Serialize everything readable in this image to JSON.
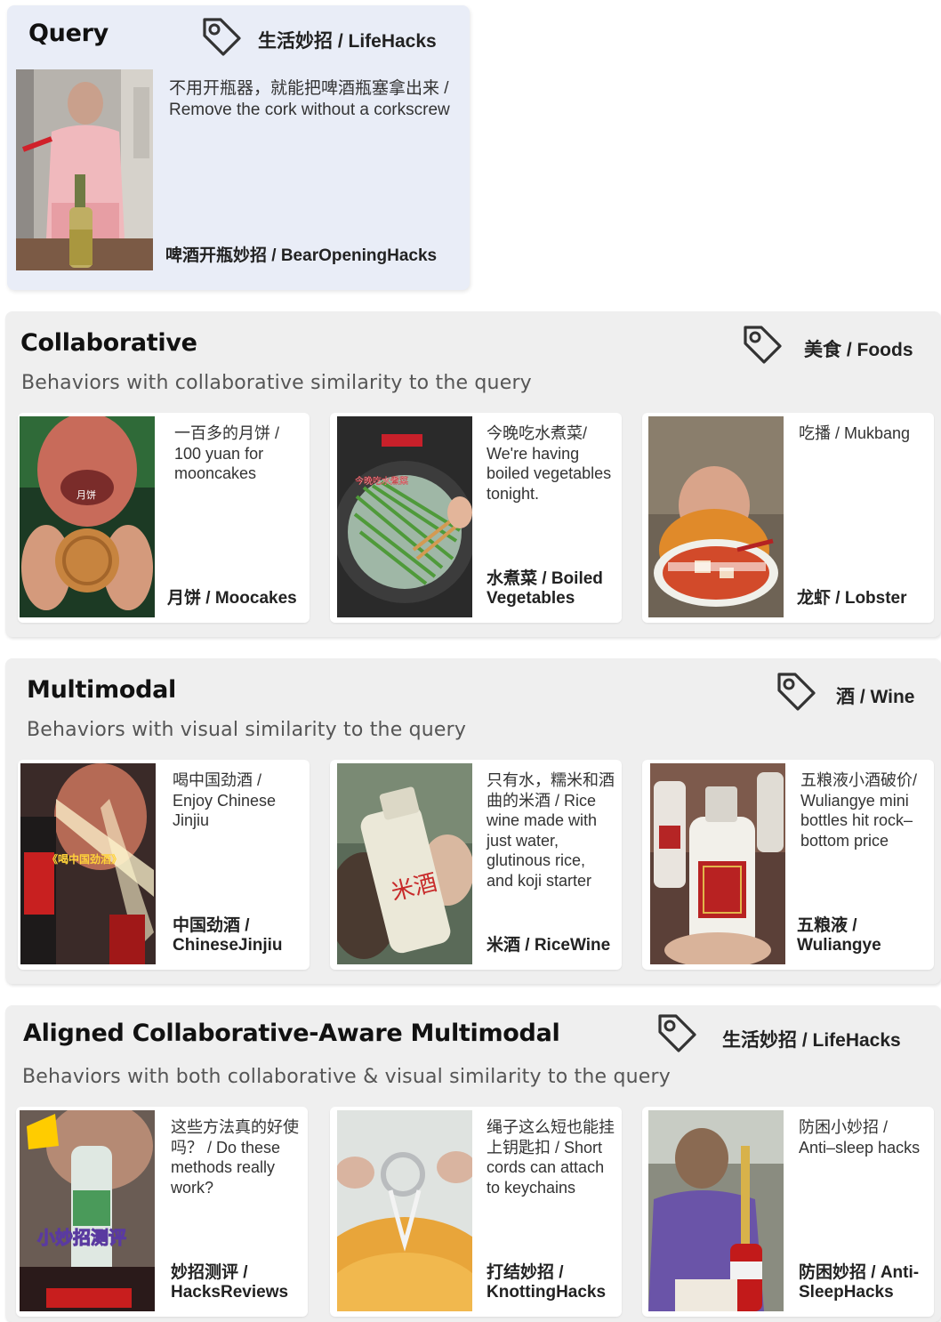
{
  "query": {
    "title": "Query",
    "tag": "生活妙招 / LifeHacks",
    "tag_icon": "tag-icon",
    "description": "不用开瓶器，就能把啤酒瓶塞拿出来 / Remove the cork without a corkscrew",
    "label": "啤酒开瓶妙招 / BearOpeningHacks"
  },
  "sections": [
    {
      "title": "Collaborative",
      "subtitle": "Behaviors with collaborative similarity to the query",
      "tag": "美食 / Foods",
      "tag_icon": "tag-icon",
      "cards": [
        {
          "description": "一百多的月饼 / 100 yuan for mooncakes",
          "label": "月饼 / Moocakes",
          "thumb_caption": "月饼"
        },
        {
          "description": "今晚吃水煮菜/ We're having boiled vegetables tonight.",
          "label": "水煮菜 / Boiled Vegetables",
          "thumb_caption": "今晚吃水煮菜"
        },
        {
          "description": "吃播 / Mukbang",
          "label": "龙虾 / Lobster",
          "thumb_caption": ""
        }
      ]
    },
    {
      "title": "Multimodal",
      "subtitle": "Behaviors with visual similarity to the query",
      "tag": "酒 / Wine",
      "tag_icon": "tag-icon",
      "cards": [
        {
          "description": "喝中国劲酒 / Enjoy Chinese Jinjiu",
          "label": "中国劲酒 / ChineseJinjiu",
          "thumb_caption": "《喝中国劲酒》"
        },
        {
          "description": "只有水，糯米和酒曲的米酒 / Rice wine made with just water, glutinous rice, and koji starter",
          "label": "米酒 / RiceWine",
          "thumb_caption": "米酒"
        },
        {
          "description": "五粮液小酒破价/ Wuliangye mini bottles hit rock–bottom price",
          "label": "五粮液 / Wuliangye",
          "thumb_caption": ""
        }
      ]
    },
    {
      "title": "Aligned Collaborative-Aware Multimodal",
      "subtitle": "Behaviors with both collaborative & visual similarity to the query",
      "tag": "生活妙招 / LifeHacks",
      "tag_icon": "tag-icon",
      "cards": [
        {
          "description": "这些方法真的好使吗？ / Do these methods really work?",
          "label": "妙招测评 / HacksReviews",
          "thumb_caption": "小妙招测评"
        },
        {
          "description": "绳子这么短也能挂上钥匙扣 / Short cords can attach to keychains",
          "label": "打结妙招 / KnottingHacks",
          "thumb_caption": ""
        },
        {
          "description": "防困小妙招 / Anti–sleep hacks",
          "label": "防困妙招 / Anti-SleepHacks",
          "thumb_caption": ""
        }
      ]
    }
  ]
}
